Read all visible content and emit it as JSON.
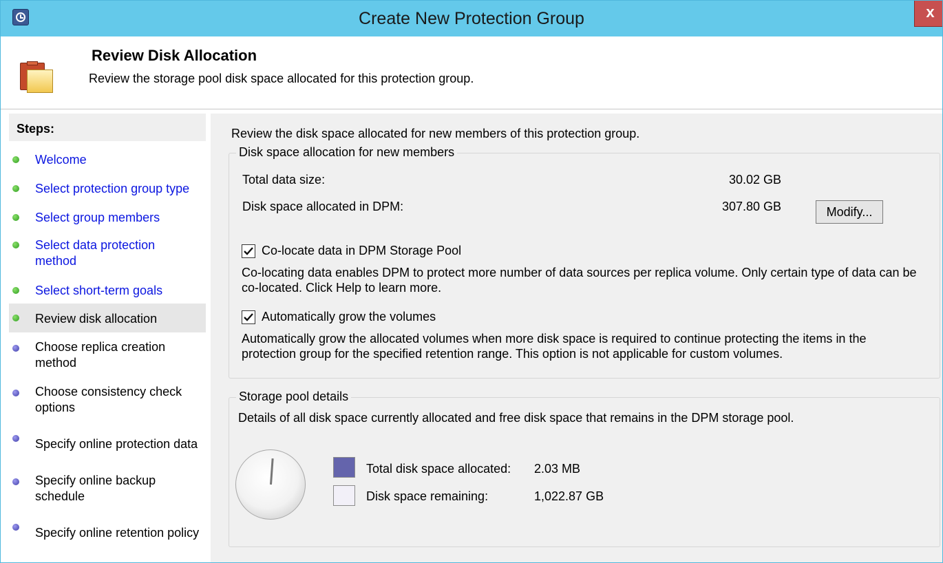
{
  "window": {
    "title": "Create New Protection Group",
    "close_glyph": "x"
  },
  "header": {
    "title": "Review Disk Allocation",
    "subtitle": "Review the storage pool disk space allocated for this protection group."
  },
  "steps": {
    "heading": "Steps:",
    "items": [
      {
        "label": "Welcome",
        "status": "completed"
      },
      {
        "label": "Select protection group type",
        "status": "completed"
      },
      {
        "label": "Select group members",
        "status": "completed"
      },
      {
        "label": "Select data protection method",
        "status": "completed"
      },
      {
        "label": "Select short-term goals",
        "status": "completed"
      },
      {
        "label": "Review disk allocation",
        "status": "current"
      },
      {
        "label": "Choose replica creation method",
        "status": "pending"
      },
      {
        "label": "Choose consistency check options",
        "status": "pending"
      },
      {
        "label": "Specify online protection data",
        "status": "pending"
      },
      {
        "label": "Specify online backup schedule",
        "status": "pending"
      },
      {
        "label": "Specify online retention policy",
        "status": "pending"
      }
    ]
  },
  "content": {
    "intro": "Review the disk space allocated for new members of this protection group.",
    "allocation": {
      "title": "Disk space allocation for new members",
      "total_data_label": "Total data size:",
      "total_data_value": "30.02 GB",
      "disk_allocated_label": "Disk space allocated in DPM:",
      "disk_allocated_value": "307.80 GB",
      "modify_button": "Modify...",
      "colocate": {
        "label": "Co-locate data in DPM Storage Pool",
        "checked": true,
        "description": "Co-locating data enables DPM to protect more number of data sources per replica volume. Only certain type of data can be co-located. Click Help to learn more."
      },
      "autogrow": {
        "label": "Automatically grow the volumes",
        "checked": true,
        "description": "Automatically grow the allocated volumes when more disk space is required to continue protecting the items in the protection group for the specified retention range. This option is not applicable for custom volumes."
      }
    },
    "pool": {
      "title": "Storage pool details",
      "description": "Details of all disk space currently allocated and free disk space that remains in the DPM storage pool.",
      "allocated_label": "Total disk space allocated:",
      "allocated_value": "2.03 MB",
      "remaining_label": "Disk space remaining:",
      "remaining_value": "1,022.87 GB"
    }
  },
  "colors": {
    "titlebar": "#64c9ea",
    "close": "#c75050",
    "link": "#0b16e0",
    "allocated_swatch": "#6464ac",
    "remaining_swatch": "#f2f0f8"
  },
  "icons": [
    "dpm-app-icon",
    "close-icon",
    "folder-icon",
    "step-status-dot-icon",
    "checkmark-icon",
    "pie-gauge-icon"
  ]
}
